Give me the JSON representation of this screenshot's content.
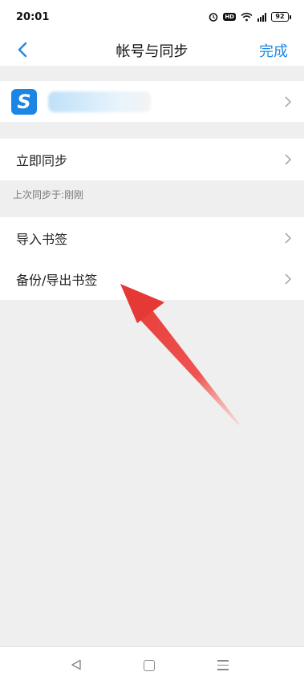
{
  "status_bar": {
    "time": "20:01",
    "hd": "HD",
    "battery": "92"
  },
  "nav": {
    "title": "帐号与同步",
    "done_label": "完成"
  },
  "account": {
    "logo_letter": "S"
  },
  "sync": {
    "label": "立即同步",
    "hint": "上次同步于:刚刚"
  },
  "bookmarks": {
    "import_label": "导入书签",
    "export_label": "备份/导出书签"
  },
  "colors": {
    "accent": "#1e88e5",
    "arrow": "#e53935",
    "background": "#efefef"
  },
  "icons": [
    "back-chevron-icon",
    "chevron-right-icon",
    "alarm-icon",
    "wifi-icon",
    "signal-icon",
    "battery-icon",
    "red-arrow-annotation"
  ]
}
